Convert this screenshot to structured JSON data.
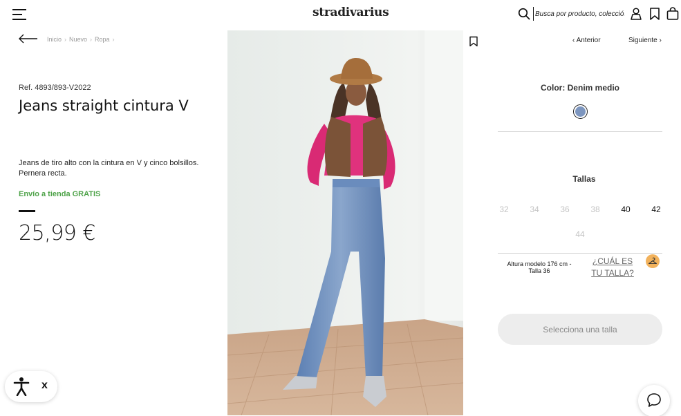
{
  "brand": {
    "name": "stradivarius"
  },
  "header": {
    "search_placeholder": "Busca por producto, colección...",
    "icons": [
      "menu-icon",
      "search-icon",
      "user-icon",
      "bookmark-icon",
      "bag-icon"
    ]
  },
  "breadcrumb": {
    "items": [
      "Inicio",
      "Nuevo",
      "Ropa"
    ]
  },
  "product": {
    "ref": "Ref. 4893/893-V2022",
    "title": "Jeans straight cintura V",
    "description": "Jeans de tiro alto con la cintura en V y cinco bolsillos. Pernera recta.",
    "shipping": "Envío a tienda GRATIS",
    "price": "25,99 €"
  },
  "navigation": {
    "prev": "Anterior",
    "next": "Siguiente"
  },
  "color": {
    "label": "Color: Denim medio",
    "swatch": "#7d96bf"
  },
  "sizes": {
    "label": "Tallas",
    "items": [
      {
        "label": "32",
        "available": false
      },
      {
        "label": "34",
        "available": false
      },
      {
        "label": "36",
        "available": false
      },
      {
        "label": "38",
        "available": false
      },
      {
        "label": "40",
        "available": true
      },
      {
        "label": "42",
        "available": true
      },
      {
        "label": "44",
        "available": false
      }
    ],
    "model_info": "Altura modelo 176 cm - Talla 36",
    "guide_link": "¿CUÁL ES TU TALLA?",
    "cta": "Selecciona una talla"
  },
  "accessibility": {
    "close": "x"
  },
  "colors": {
    "accent_green": "#4fa34a",
    "hanger_badge": "#f2b25c",
    "cta_bg": "#ededed"
  }
}
